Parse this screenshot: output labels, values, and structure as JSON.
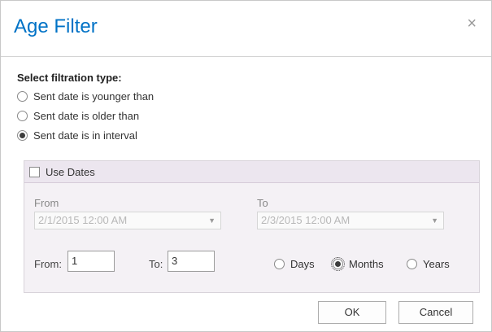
{
  "dialog": {
    "title": "Age Filter",
    "close_glyph": "×"
  },
  "filtration": {
    "label": "Select filtration type:",
    "options": [
      {
        "label": "Sent date is younger than",
        "selected": false
      },
      {
        "label": "Sent date is older than",
        "selected": false
      },
      {
        "label": "Sent date is in interval",
        "selected": true
      }
    ]
  },
  "interval": {
    "use_dates_label": "Use Dates",
    "use_dates_checked": false,
    "from_date_label": "From",
    "from_date_value": "2/1/2015 12:00 AM",
    "to_date_label": "To",
    "to_date_value": "2/3/2015 12:00 AM",
    "from_num_label": "From:",
    "from_num_value": "1",
    "to_num_label": "To:",
    "to_num_value": "3",
    "units": [
      {
        "label": "Days",
        "selected": false
      },
      {
        "label": "Months",
        "selected": true
      },
      {
        "label": "Years",
        "selected": false
      }
    ]
  },
  "buttons": {
    "ok": "OK",
    "cancel": "Cancel"
  },
  "colors": {
    "title": "#0072c6",
    "panel_bg": "#f4f1f5",
    "panel_header_bg": "#ece6ef"
  }
}
